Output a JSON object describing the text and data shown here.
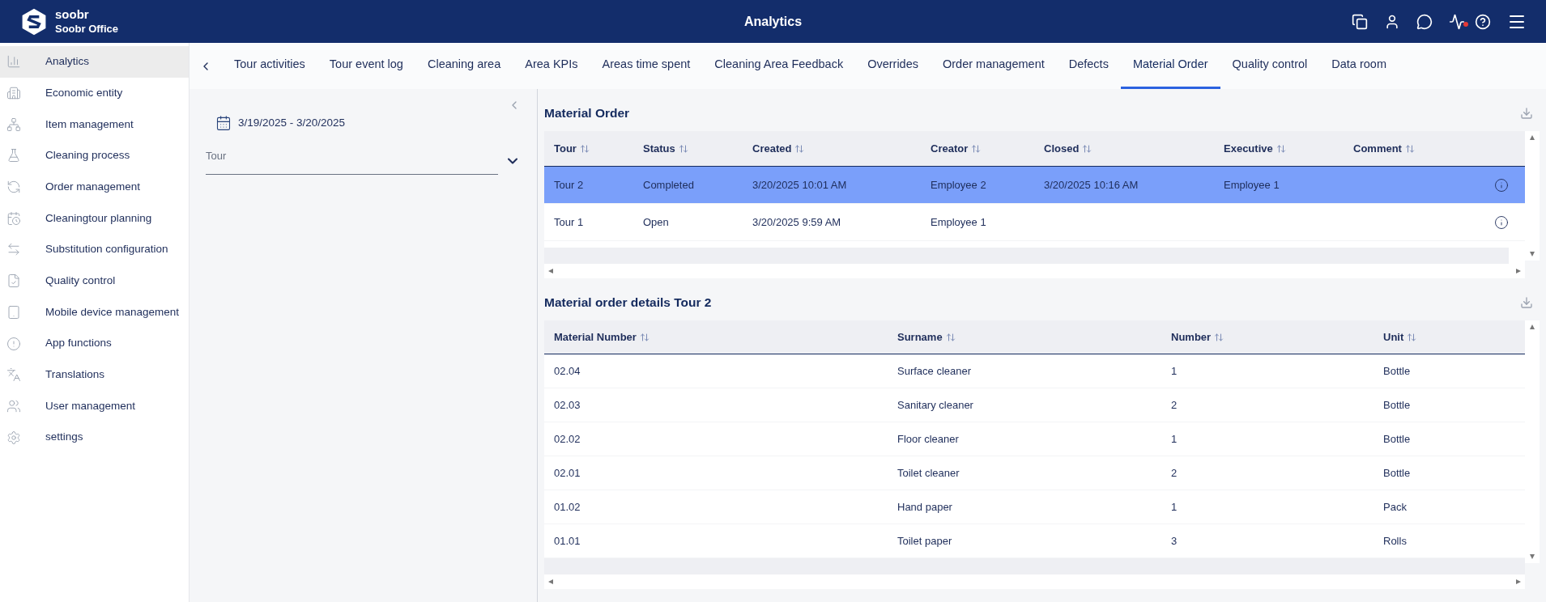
{
  "app": {
    "brand": "soobr",
    "subtitle": "Soobr Office",
    "title": "Analytics",
    "activity_alert": true
  },
  "sidebar": {
    "items": [
      {
        "label": "Analytics",
        "selected": true
      },
      {
        "label": "Economic entity",
        "selected": false
      },
      {
        "label": "Item management",
        "selected": false
      },
      {
        "label": "Cleaning process",
        "selected": false
      },
      {
        "label": "Order management",
        "selected": false
      },
      {
        "label": "Cleaningtour planning",
        "selected": false
      },
      {
        "label": "Substitution configuration",
        "selected": false
      },
      {
        "label": "Quality control",
        "selected": false
      },
      {
        "label": "Mobile device management",
        "selected": false
      },
      {
        "label": "App functions",
        "selected": false
      },
      {
        "label": "Translations",
        "selected": false
      },
      {
        "label": "User management",
        "selected": false
      },
      {
        "label": "settings",
        "selected": false
      }
    ]
  },
  "tabs": [
    {
      "label": "Tour activities",
      "selected": false
    },
    {
      "label": "Tour event log",
      "selected": false
    },
    {
      "label": "Cleaning area",
      "selected": false
    },
    {
      "label": "Area KPIs",
      "selected": false
    },
    {
      "label": "Areas time spent",
      "selected": false
    },
    {
      "label": "Cleaning Area Feedback",
      "selected": false
    },
    {
      "label": "Overrides",
      "selected": false
    },
    {
      "label": "Order management",
      "selected": false
    },
    {
      "label": "Defects",
      "selected": false
    },
    {
      "label": "Material Order",
      "selected": true
    },
    {
      "label": "Quality control",
      "selected": false
    },
    {
      "label": "Data room",
      "selected": false
    }
  ],
  "filters": {
    "date_range": "3/19/2025 - 3/20/2025",
    "tour": {
      "placeholder": "Tour"
    }
  },
  "orders": {
    "title": "Material Order",
    "columns": [
      "Tour",
      "Status",
      "Created",
      "Creator",
      "Closed",
      "Executive",
      "Comment"
    ],
    "rows": [
      {
        "cells": [
          "Tour 2",
          "Completed",
          "3/20/2025 10:01 AM",
          "Employee 2",
          "3/20/2025 10:16 AM",
          "Employee 1",
          ""
        ],
        "selected": true
      },
      {
        "cells": [
          "Tour 1",
          "Open",
          "3/20/2025 9:59 AM",
          "Employee 1",
          "",
          "",
          ""
        ],
        "selected": false
      }
    ]
  },
  "details": {
    "title": "Material order details Tour 2",
    "columns": [
      "Material Number",
      "Surname",
      "Number",
      "Unit"
    ],
    "rows": [
      [
        "02.04",
        "Surface cleaner",
        "1",
        "Bottle"
      ],
      [
        "02.03",
        "Sanitary cleaner",
        "2",
        "Bottle"
      ],
      [
        "02.02",
        "Floor cleaner",
        "1",
        "Bottle"
      ],
      [
        "02.01",
        "Toilet cleaner",
        "2",
        "Bottle"
      ],
      [
        "01.02",
        "Hand paper",
        "1",
        "Pack"
      ],
      [
        "01.01",
        "Toilet paper",
        "3",
        "Rolls"
      ]
    ]
  }
}
